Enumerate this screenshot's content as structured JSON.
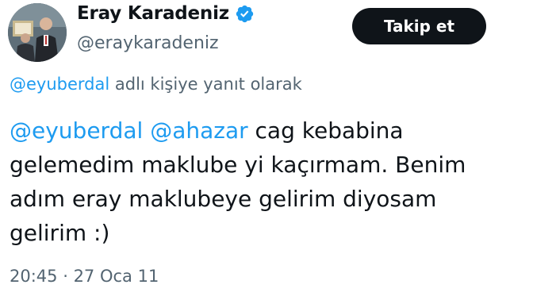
{
  "author": {
    "display_name": "Eray Karadeniz",
    "handle": "@eraykaradeniz",
    "verified_icon": "verified-badge-icon",
    "avatar": "profile-photo"
  },
  "follow_button": {
    "label": "Takip et"
  },
  "reply_context": {
    "mention": "@eyuberdal",
    "text": " adlı kişiye yanıt olarak"
  },
  "tweet": {
    "mention_1": "@eyuberdal",
    "mention_2": "@ahazar",
    "line_1_text": " cag kebabina",
    "line_2": "gelemedim maklube yi kaçırmam. Benim",
    "line_3": "adım eray maklubeye gelirim diyosam",
    "line_4": "gelirim :)"
  },
  "meta": {
    "time": "20:45",
    "separator": " · ",
    "date": "27 Oca 11"
  },
  "colors": {
    "link": "#1d9bf0",
    "secondary_text": "#536471",
    "primary_text": "#0f1419",
    "button_bg": "#0f1419",
    "verified": "#1d9bf0"
  }
}
